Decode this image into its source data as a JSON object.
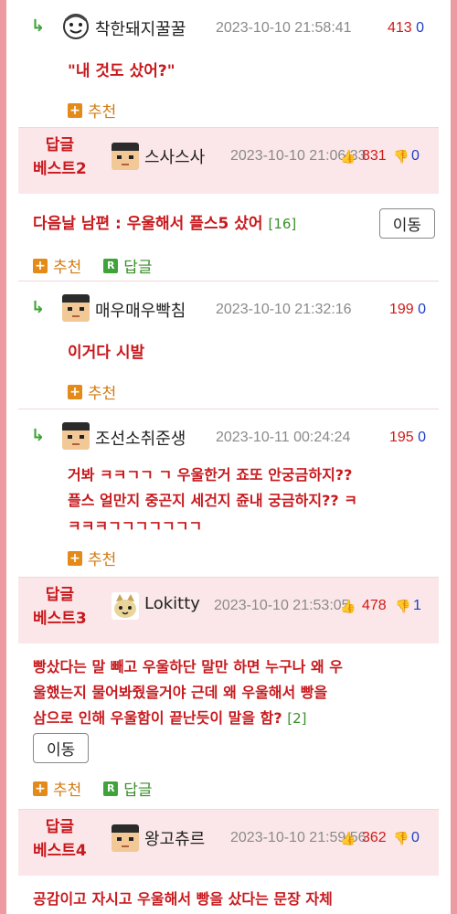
{
  "comments": [
    {
      "type": "reply",
      "nick": "착한돼지꿀꿀",
      "date": "2023-10-10 21:58:41",
      "up": "413",
      "down": "0",
      "text": "\"내 것도 샀어?\"",
      "recommend_label": "추천",
      "avatar_icon": "smiling-face-avatar-icon"
    },
    {
      "type": "best",
      "badge_line1": "답글",
      "badge_line2": "베스트2",
      "nick": "스사스사",
      "date": "2023-10-10 21:06:33",
      "up": "831",
      "down": "0",
      "text": "다음날 남편 : 우울해서 플스5 샀어",
      "count": "[16]",
      "move_label": "이동",
      "recommend_label": "추천",
      "reply_label": "답글",
      "avatar_icon": "pixel-face-avatar-icon"
    },
    {
      "type": "reply",
      "nick": "매우매우빡침",
      "date": "2023-10-10 21:32:16",
      "up": "199",
      "down": "0",
      "text": "이거다 시발",
      "recommend_label": "추천",
      "avatar_icon": "pixel-face-avatar-icon"
    },
    {
      "type": "reply",
      "nick": "조선소취준생",
      "date": "2023-10-11 00:24:24",
      "up": "195",
      "down": "0",
      "text_line1": "거봐 ㅋㅋㄱㄱ ㄱ 우울한거 죠또 안궁금하지??",
      "text_line2": "플스 얼만지 중곤지 세건지 쥰내 궁금하지?? ㅋ",
      "text_line3": "ㅋㅋㅋㄱㄱㄱㄱㄱㄱㄱ",
      "recommend_label": "추천",
      "avatar_icon": "pixel-face-avatar-icon"
    },
    {
      "type": "best",
      "badge_line1": "답글",
      "badge_line2": "베스트3",
      "nick": "Lokitty",
      "date": "2023-10-10 21:53:05",
      "up": "478",
      "down": "1",
      "text_line1": "빵샀다는 말 빼고 우울하단 말만 하면 누구나 왜 우",
      "text_line2": "울했는지 물어봐줬을거야 근데 왜 우울해서 빵을",
      "text_line3": "삼으로 인해 우울함이 끝난듯이 말을 함?",
      "count": "[2]",
      "move_label": "이동",
      "recommend_label": "추천",
      "reply_label": "답글",
      "avatar_icon": "cat-avatar-icon"
    },
    {
      "type": "best",
      "badge_line1": "답글",
      "badge_line2": "베스트4",
      "nick": "왕고츄르",
      "date": "2023-10-10 21:59:56",
      "up": "362",
      "down": "0",
      "text": "공감이고 자시고 우울해서 빵을 샀다는 문장 자체",
      "avatar_icon": "pixel-face-avatar-icon"
    }
  ],
  "colors": {
    "accent_red": "#c8191d",
    "frame_pink": "#ee9aa2",
    "best_bg": "#fbe7e9",
    "down_blue": "#1d3fc4",
    "reply_green": "#3a8f2b"
  }
}
